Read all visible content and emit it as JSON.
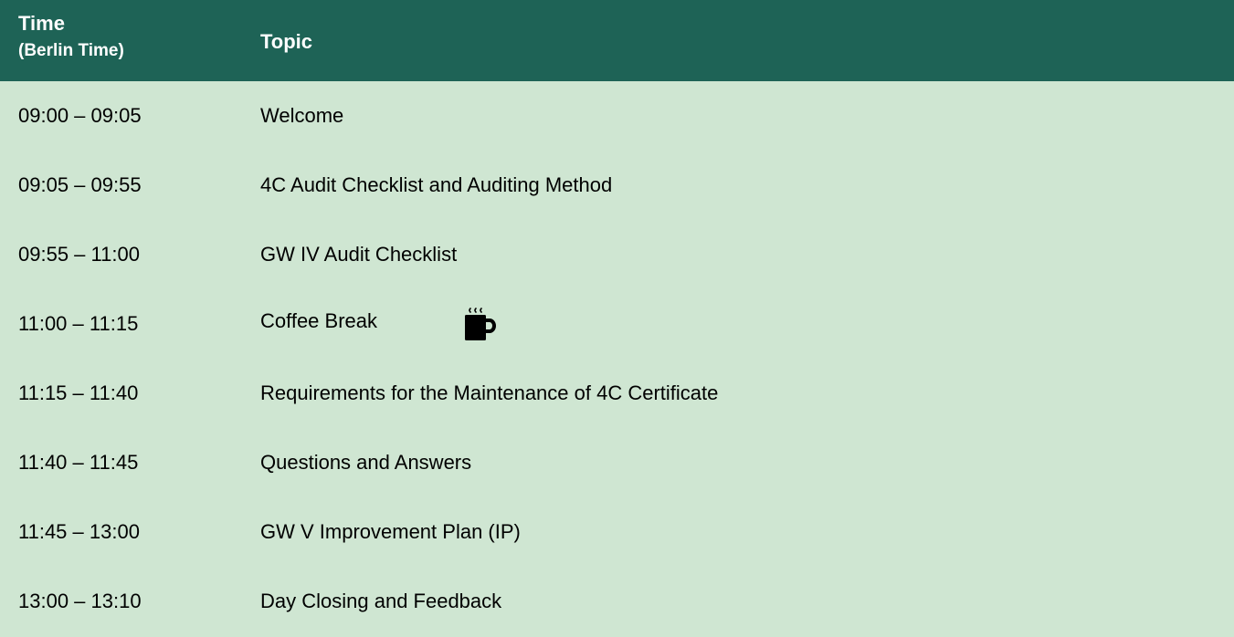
{
  "header": {
    "time_label": "Time",
    "time_sublabel": "(Berlin Time)",
    "topic_label": "Topic"
  },
  "rows": [
    {
      "time": "09:00 – 09:05",
      "topic": "Welcome"
    },
    {
      "time": "09:05 – 09:55",
      "topic": "4C Audit Checklist and Auditing Method"
    },
    {
      "time": "09:55 – 11:00",
      "topic": "GW IV Audit Checklist"
    },
    {
      "time": "11:00 – 11:15",
      "topic": "Coffee Break",
      "icon": "coffee-cup-icon"
    },
    {
      "time": "11:15 – 11:40",
      "topic": "Requirements for the Maintenance of 4C Certificate"
    },
    {
      "time": "11:40 – 11:45",
      "topic": "Questions and Answers"
    },
    {
      "time": "11:45 – 13:00",
      "topic": "GW V Improvement Plan (IP)"
    },
    {
      "time": "13:00 – 13:10",
      "topic": "Day Closing and Feedback"
    }
  ],
  "colors": {
    "header_bg": "#1e6356",
    "header_text": "#ffffff",
    "body_bg": "#cfe6d2",
    "body_text": "#000000"
  }
}
